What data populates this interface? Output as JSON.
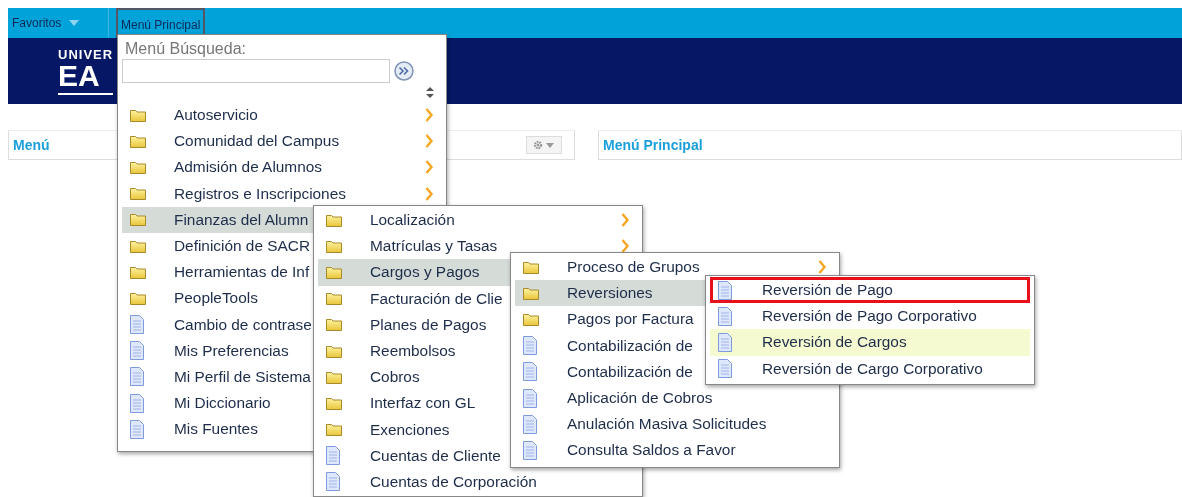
{
  "nav": {
    "items": [
      {
        "label": "Favoritos",
        "kind": "dropdown",
        "selected": false
      },
      {
        "label": "Menú Principal",
        "kind": "plain",
        "selected": true
      }
    ]
  },
  "banner": {
    "logo_lines": [
      "UNIVER",
      "EA"
    ]
  },
  "panels": [
    {
      "title": "Menú",
      "kind": "settings"
    },
    {
      "title": "Menú Principal",
      "kind": "plain"
    }
  ],
  "search": {
    "label": "Menú Búsqueda:"
  },
  "menus": [
    {
      "items": [
        {
          "label": "Autoservicio",
          "kind": "folder",
          "arrow": true,
          "selected": false
        },
        {
          "label": "Comunidad del Campus",
          "kind": "folder",
          "arrow": true,
          "selected": false
        },
        {
          "label": "Admisión de Alumnos",
          "kind": "folder",
          "arrow": true,
          "selected": false
        },
        {
          "label": "Registros e Inscripciones",
          "kind": "folder",
          "arrow": true,
          "selected": false
        },
        {
          "label": "Finanzas del Alumn",
          "kind": "folder",
          "arrow": false,
          "selected": true
        },
        {
          "label": "Definición de SACR",
          "kind": "folder",
          "arrow": false,
          "selected": false
        },
        {
          "label": "Herramientas de Inf",
          "kind": "folder",
          "arrow": false,
          "selected": false
        },
        {
          "label": "PeopleTools",
          "kind": "folder",
          "arrow": false,
          "selected": false
        },
        {
          "label": "Cambio de contrase",
          "kind": "page",
          "arrow": false,
          "selected": false
        },
        {
          "label": "Mis Preferencias",
          "kind": "page",
          "arrow": false,
          "selected": false
        },
        {
          "label": "Mi Perfil de Sistema",
          "kind": "page",
          "arrow": false,
          "selected": false
        },
        {
          "label": "Mi Diccionario",
          "kind": "page",
          "arrow": false,
          "selected": false
        },
        {
          "label": "Mis Fuentes",
          "kind": "page",
          "arrow": false,
          "selected": false
        }
      ]
    },
    {
      "items": [
        {
          "label": "Localización",
          "kind": "folder",
          "arrow": true,
          "selected": false
        },
        {
          "label": "Matrículas y Tasas",
          "kind": "folder",
          "arrow": true,
          "selected": false
        },
        {
          "label": "Cargos y Pagos",
          "kind": "folder",
          "arrow": false,
          "selected": true
        },
        {
          "label": "Facturación de Clie",
          "kind": "folder",
          "arrow": false,
          "selected": false
        },
        {
          "label": "Planes de Pagos",
          "kind": "folder",
          "arrow": false,
          "selected": false
        },
        {
          "label": "Reembolsos",
          "kind": "folder",
          "arrow": false,
          "selected": false
        },
        {
          "label": "Cobros",
          "kind": "folder",
          "arrow": false,
          "selected": false
        },
        {
          "label": "Interfaz con GL",
          "kind": "folder",
          "arrow": false,
          "selected": false
        },
        {
          "label": "Exenciones",
          "kind": "folder",
          "arrow": false,
          "selected": false
        },
        {
          "label": "Cuentas de Cliente",
          "kind": "page",
          "arrow": false,
          "selected": false
        },
        {
          "label": "Cuentas de Corporación",
          "kind": "page",
          "arrow": false,
          "selected": false
        }
      ]
    },
    {
      "items": [
        {
          "label": "Proceso de Grupos",
          "kind": "folder",
          "arrow": true,
          "selected": false
        },
        {
          "label": "Reversiones",
          "kind": "folder",
          "arrow": false,
          "selected": true
        },
        {
          "label": "Pagos por Factura",
          "kind": "folder",
          "arrow": false,
          "selected": false
        },
        {
          "label": "Contabilización de",
          "kind": "page",
          "arrow": false,
          "selected": false
        },
        {
          "label": "Contabilización de",
          "kind": "page",
          "arrow": false,
          "selected": false
        },
        {
          "label": "Aplicación de Cobros",
          "kind": "page",
          "arrow": false,
          "selected": false
        },
        {
          "label": "Anulación Masiva Solicitudes",
          "kind": "page",
          "arrow": false,
          "selected": false
        },
        {
          "label": "Consulta Saldos a Favor",
          "kind": "page",
          "arrow": false,
          "selected": false
        }
      ]
    },
    {
      "items": [
        {
          "label": "Reversión de Pago",
          "kind": "page",
          "arrow": false,
          "selected": false,
          "hovered": false,
          "outlined": true
        },
        {
          "label": "Reversión de Pago Corporativo",
          "kind": "page",
          "arrow": false,
          "selected": false,
          "hovered": false,
          "outlined": false
        },
        {
          "label": "Reversión de Cargos",
          "kind": "page",
          "arrow": false,
          "selected": false,
          "hovered": true,
          "outlined": false
        },
        {
          "label": "Reversión de Cargo Corporativo",
          "kind": "page",
          "arrow": false,
          "selected": false,
          "hovered": false,
          "outlined": false
        }
      ]
    }
  ]
}
